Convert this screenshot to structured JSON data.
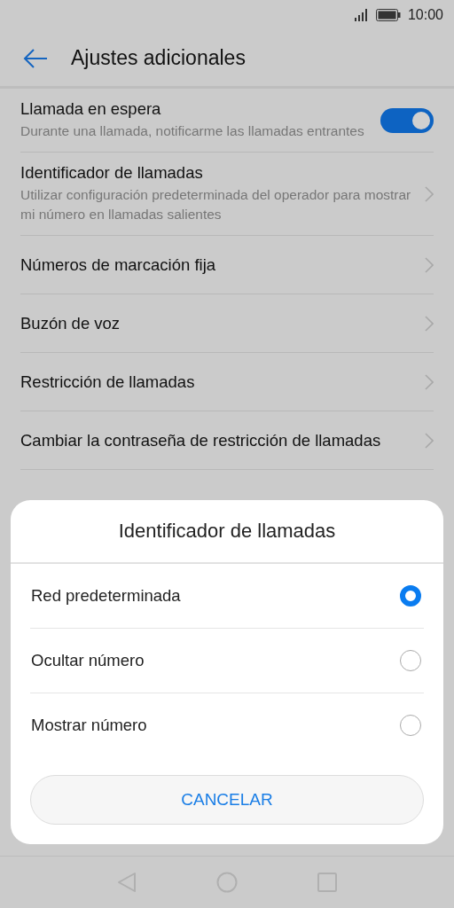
{
  "status_bar": {
    "time": "10:00"
  },
  "header": {
    "title": "Ajustes adicionales"
  },
  "settings": [
    {
      "kind": "toggle",
      "title": "Llamada en espera",
      "subtitle": "Durante una llamada, notificarme las llamadas entrantes",
      "on": true
    },
    {
      "kind": "link",
      "title": "Identificador de llamadas",
      "subtitle": "Utilizar configuración predeterminada del operador para mostrar mi número en llamadas salientes"
    },
    {
      "kind": "link",
      "title": "Números de marcación fija"
    },
    {
      "kind": "link",
      "title": "Buzón de voz"
    },
    {
      "kind": "link",
      "title": "Restricción de llamadas"
    },
    {
      "kind": "link",
      "title": "Cambiar la contraseña de restricción de llamadas"
    }
  ],
  "dialog": {
    "title": "Identificador de llamadas",
    "options": [
      {
        "label": "Red predeterminada",
        "selected": true
      },
      {
        "label": "Ocultar número",
        "selected": false
      },
      {
        "label": "Mostrar número",
        "selected": false
      }
    ],
    "cancel": "CANCELAR"
  }
}
